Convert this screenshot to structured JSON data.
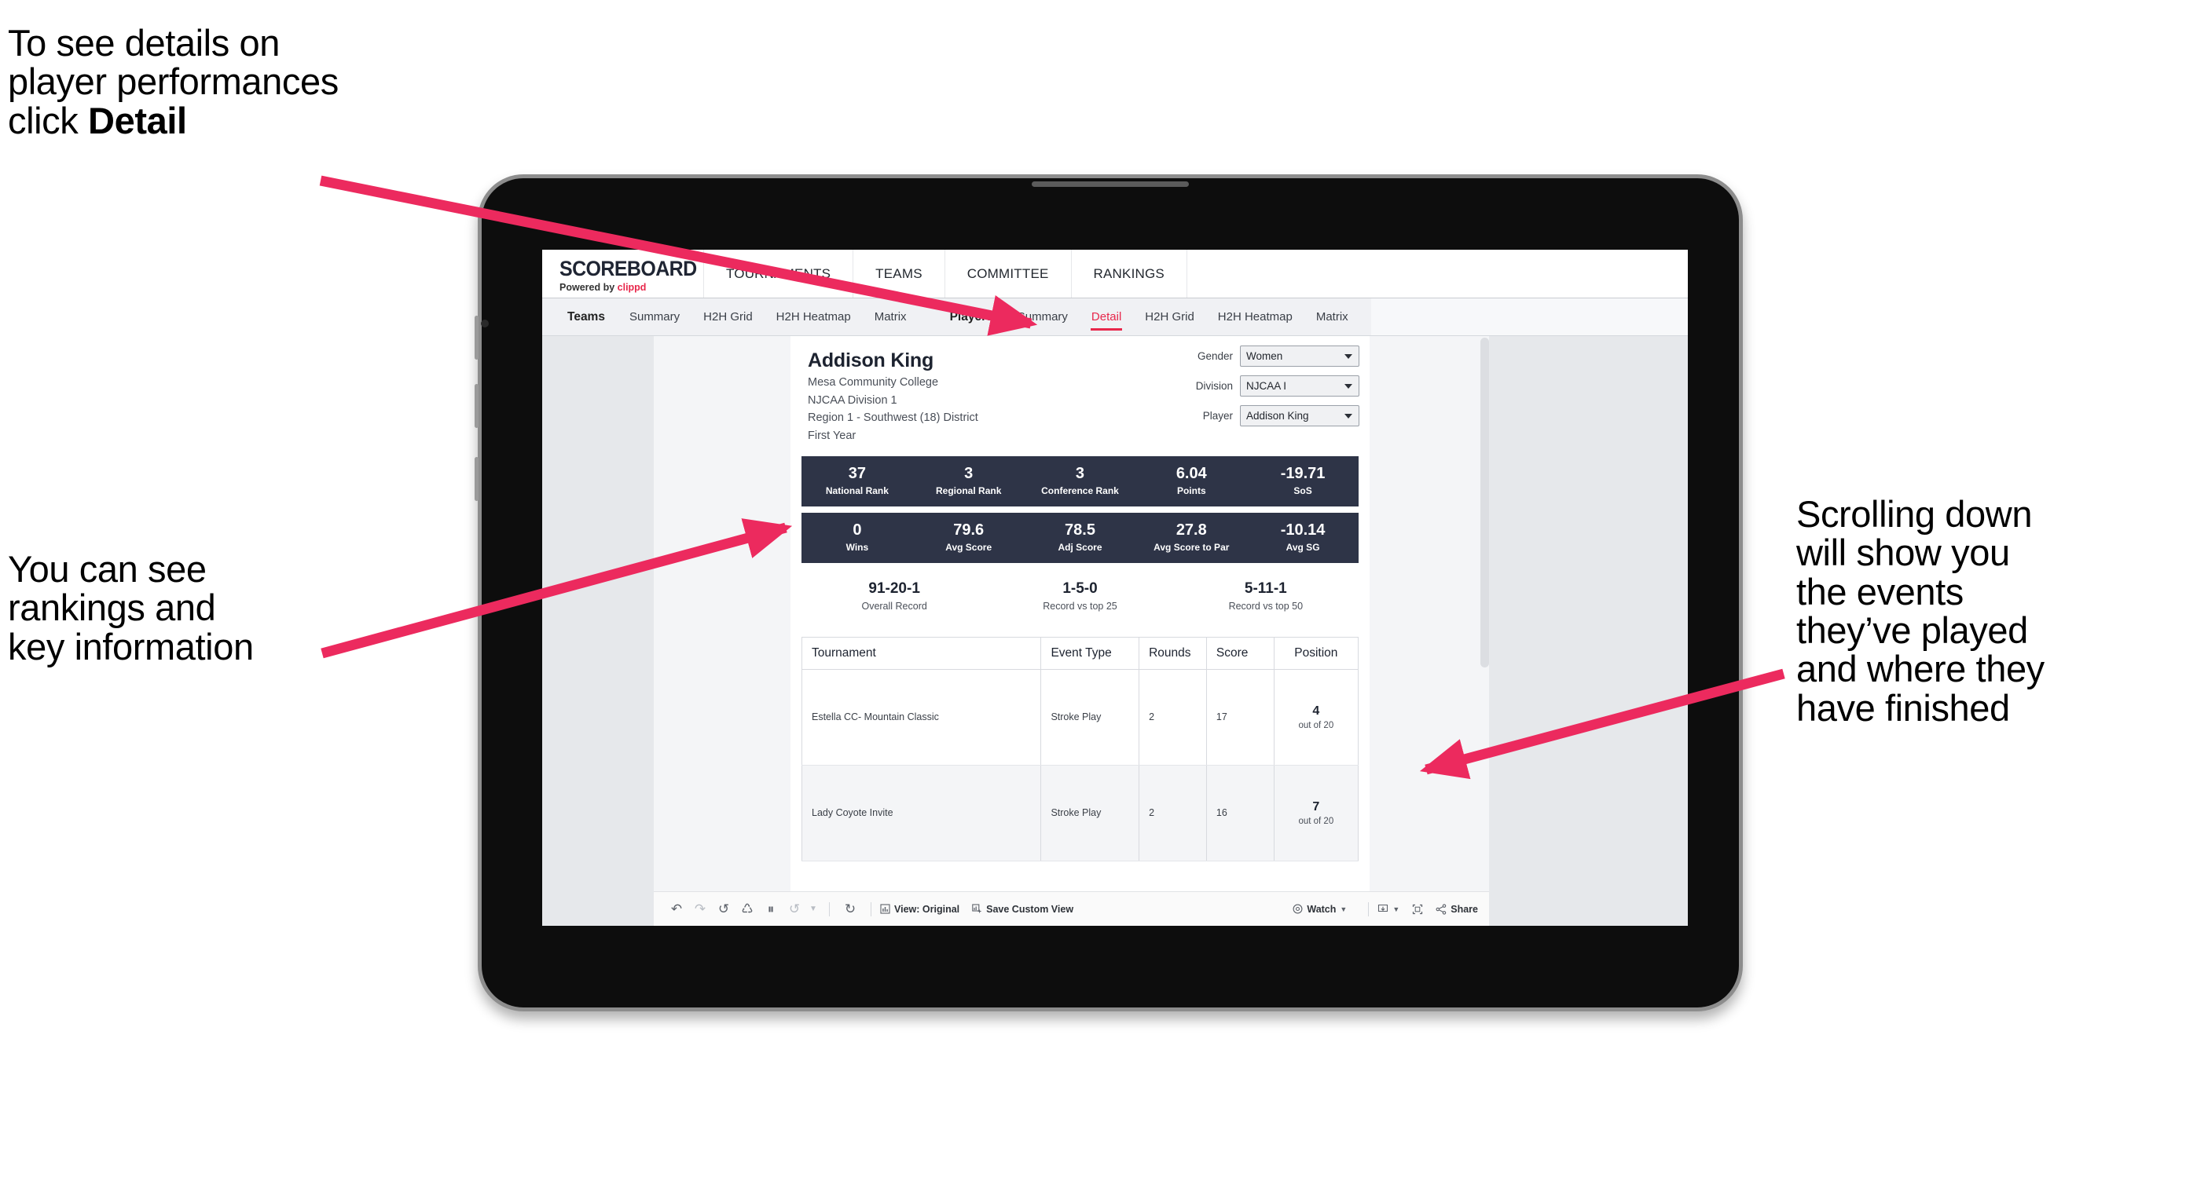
{
  "annotations": {
    "top_left": "To see details on\nplayer performances\nclick ",
    "top_left_bold": "Detail",
    "mid_left": "You can see\nrankings and\nkey information",
    "right": "Scrolling down\nwill show you\nthe events\nthey’ve played\nand where they\nhave finished",
    "arrow_color": "#ec2a5e"
  },
  "app": {
    "brand": {
      "name": "SCOREBOARD",
      "tagline_prefix": "Powered by ",
      "tagline_brand": "clippd"
    },
    "top_nav": [
      "TOURNAMENTS",
      "TEAMS",
      "COMMITTEE",
      "RANKINGS"
    ],
    "sub_nav": {
      "teams_group": {
        "lead": "Teams",
        "items": [
          "Summary",
          "H2H Grid",
          "H2H Heatmap",
          "Matrix"
        ]
      },
      "players_group": {
        "lead": "Players",
        "items": [
          "Summary",
          "Detail",
          "H2H Grid",
          "H2H Heatmap",
          "Matrix"
        ],
        "active": "Detail"
      }
    }
  },
  "player": {
    "name": "Addison King",
    "school": "Mesa Community College",
    "division": "NJCAA Division 1",
    "region": "Region 1 - Southwest (18) District",
    "year": "First Year"
  },
  "filters": [
    {
      "label": "Gender",
      "value": "Women"
    },
    {
      "label": "Division",
      "value": "NJCAA I"
    },
    {
      "label": "Player",
      "value": "Addison King"
    }
  ],
  "stats_row_1": [
    {
      "value": "37",
      "label": "National Rank"
    },
    {
      "value": "3",
      "label": "Regional Rank"
    },
    {
      "value": "3",
      "label": "Conference Rank"
    },
    {
      "value": "6.04",
      "label": "Points"
    },
    {
      "value": "-19.71",
      "label": "SoS"
    }
  ],
  "stats_row_2": [
    {
      "value": "0",
      "label": "Wins"
    },
    {
      "value": "79.6",
      "label": "Avg Score"
    },
    {
      "value": "78.5",
      "label": "Adj Score"
    },
    {
      "value": "27.8",
      "label": "Avg Score to Par"
    },
    {
      "value": "-10.14",
      "label": "Avg SG"
    }
  ],
  "records": [
    {
      "value": "91-20-1",
      "label": "Overall Record"
    },
    {
      "value": "1-5-0",
      "label": "Record vs top 25"
    },
    {
      "value": "5-11-1",
      "label": "Record vs top 50"
    }
  ],
  "table": {
    "headers": [
      "Tournament",
      "Event Type",
      "Rounds",
      "Score",
      "Position"
    ],
    "rows": [
      {
        "tournament": "Estella CC- Mountain Classic",
        "event_type": "Stroke Play",
        "rounds": "2",
        "score": "17",
        "position_value": "4",
        "position_label": "out of 20"
      },
      {
        "tournament": "Lady Coyote Invite",
        "event_type": "Stroke Play",
        "rounds": "2",
        "score": "16",
        "position_value": "7",
        "position_label": "out of 20"
      }
    ]
  },
  "toolbar": {
    "view_label": "View: Original",
    "save_label": "Save Custom View",
    "watch_label": "Watch",
    "share_label": "Share"
  },
  "colors": {
    "accent": "#e8274b",
    "stat_bar": "#2e3447",
    "screen_bg": "#e6e8eb",
    "arrow": "#ec2a5e"
  }
}
